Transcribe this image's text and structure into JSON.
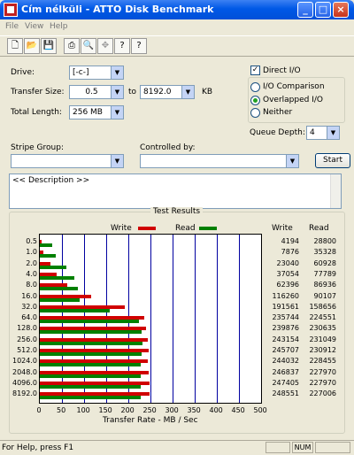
{
  "window": {
    "title": "Cím nélküli - ATTO Disk Benchmark"
  },
  "menu": [
    "File",
    "View",
    "Help"
  ],
  "toolbar_icons": [
    "new-icon",
    "open-icon",
    "save-icon",
    "print-icon",
    "print-preview-icon",
    "move-icon",
    "help-icon",
    "context-help-icon"
  ],
  "settings": {
    "drive_label": "Drive:",
    "drive_value": "[-c-]",
    "transfer_size_label": "Transfer Size:",
    "transfer_from": "0.5",
    "to_label": "to",
    "transfer_to": "8192.0",
    "kb_label": "KB",
    "total_length_label": "Total Length:",
    "total_length_value": "256 MB",
    "direct_io_label": "Direct I/O",
    "direct_io_checked": true,
    "io_comparison_label": "I/O Comparison",
    "overlapped_io_label": "Overlapped I/O",
    "neither_label": "Neither",
    "selected_mode": "Overlapped I/O",
    "queue_depth_label": "Queue Depth:",
    "queue_depth_value": "4",
    "stripe_group_label": "Stripe Group:",
    "controlled_by_label": "Controlled by:",
    "start_label": "Start",
    "description_text": "<< Description >>"
  },
  "results": {
    "title": "Test Results",
    "legend_write": "Write",
    "legend_read": "Read",
    "col_write": "Write",
    "col_read": "Read",
    "xlabel": "Transfer Rate - MB / Sec"
  },
  "chart_data": {
    "type": "bar",
    "orientation": "horizontal",
    "title": "Test Results",
    "xlabel": "Transfer Rate - MB / Sec",
    "xlim": [
      0,
      500
    ],
    "xticks": [
      "0",
      "50",
      "100",
      "150",
      "200",
      "250",
      "300",
      "350",
      "400",
      "450",
      "500"
    ],
    "categories": [
      "0.5",
      "1.0",
      "2.0",
      "4.0",
      "8.0",
      "16.0",
      "32.0",
      "64.0",
      "128.0",
      "256.0",
      "512.0",
      "1024.0",
      "2048.0",
      "4096.0",
      "8192.0"
    ],
    "series": [
      {
        "name": "Write",
        "color": "#d00000",
        "values": [
          4194,
          7876,
          23040,
          37054,
          62396,
          116260,
          191561,
          235744,
          239876,
          243154,
          245707,
          244032,
          246837,
          247405,
          248551
        ]
      },
      {
        "name": "Read",
        "color": "#008000",
        "values": [
          28800,
          35328,
          60928,
          77789,
          86936,
          90107,
          158656,
          224551,
          230635,
          231049,
          230912,
          228455,
          227970,
          227970,
          227006
        ]
      }
    ],
    "value_units": "KB/s",
    "grid": true
  },
  "status": {
    "text": "For Help, press F1",
    "num": "NUM"
  }
}
